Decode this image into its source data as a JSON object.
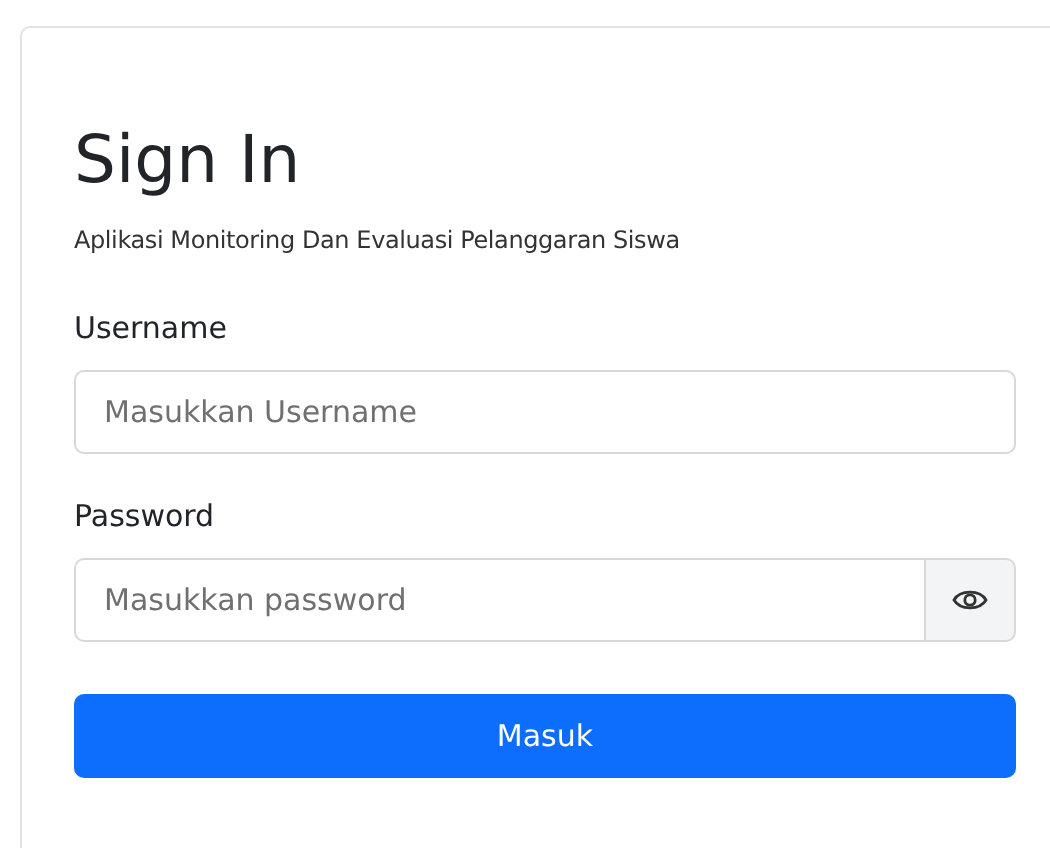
{
  "title": "Sign In",
  "subtitle": "Aplikasi Monitoring Dan Evaluasi Pelanggaran Siswa",
  "fields": [
    {
      "label": "Username",
      "placeholder": "Masukkan Username",
      "kind": "text"
    },
    {
      "label": "Password",
      "placeholder": "Masukkan password",
      "kind": "password"
    }
  ],
  "submit": "Masuk"
}
